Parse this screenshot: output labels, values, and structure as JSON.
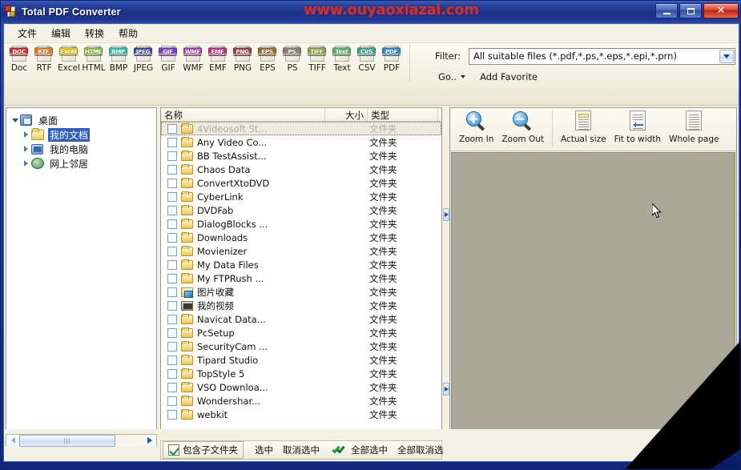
{
  "window": {
    "title": "Total PDF Converter",
    "watermark": "www.ouyaoxiazai.com",
    "minimize_label": "Minimize",
    "maximize_label": "Maximize",
    "close_label": "Close"
  },
  "menu": {
    "items": [
      {
        "label": "文件"
      },
      {
        "label": "编辑"
      },
      {
        "label": "转换"
      },
      {
        "label": "帮助"
      }
    ]
  },
  "formats": [
    {
      "label": "Doc",
      "badge": "DOC",
      "color": "#cf2b2b"
    },
    {
      "label": "RTF",
      "badge": "RTF",
      "color": "#e87722"
    },
    {
      "label": "Excel",
      "badge": "Excel",
      "color": "#e8c418"
    },
    {
      "label": "HTML",
      "badge": "HTML",
      "color": "#86c442"
    },
    {
      "label": "BMP",
      "badge": "BMP",
      "color": "#2bbfae"
    },
    {
      "label": "JPEG",
      "badge": "JPEG",
      "color": "#3647b0"
    },
    {
      "label": "GIF",
      "badge": "GIF",
      "color": "#7a3fc4"
    },
    {
      "label": "WMF",
      "badge": "WMF",
      "color": "#b03cb8"
    },
    {
      "label": "EMF",
      "badge": "EMF",
      "color": "#c42b86"
    },
    {
      "label": "PNG",
      "badge": "PNG",
      "color": "#a83a3a"
    },
    {
      "label": "EPS",
      "badge": "EPS",
      "color": "#9a6b2e"
    },
    {
      "label": "PS",
      "badge": "PS",
      "color": "#83806e"
    },
    {
      "label": "TIFF",
      "badge": "TIFF",
      "color": "#8aa642"
    },
    {
      "label": "Text",
      "badge": "Text",
      "color": "#55b36a"
    },
    {
      "label": "CSV",
      "badge": "CVS",
      "color": "#3fa58c"
    },
    {
      "label": "PDF",
      "badge": "PDF",
      "color": "#2e86c8"
    }
  ],
  "filter": {
    "label": "Filter:",
    "value": "All suitable files (*.pdf,*.ps,*.eps,*.epi,*.prn)",
    "placeholder": "All suitable files",
    "go_label": "Go..",
    "add_favorite_label": "Add Favorite"
  },
  "tree": {
    "root": {
      "label": "桌面",
      "icon": "desktop-icon"
    },
    "children": [
      {
        "label": "我的文档",
        "icon": "folder-icon",
        "selected": true
      },
      {
        "label": "我的电脑",
        "icon": "my-computer-icon",
        "selected": false
      },
      {
        "label": "网上邻居",
        "icon": "network-icon",
        "selected": false
      }
    ]
  },
  "file_list": {
    "columns": [
      {
        "key": "name",
        "label": "名称"
      },
      {
        "key": "size",
        "label": "大小"
      },
      {
        "key": "type",
        "label": "类型"
      }
    ],
    "rows": [
      {
        "name": "4Videosoft St...",
        "size": "",
        "type": "文件夹",
        "icon": "folder-icon",
        "checked": false,
        "focused": true
      },
      {
        "name": "Any Video Co...",
        "size": "",
        "type": "文件夹",
        "icon": "folder-icon",
        "checked": false,
        "focused": false
      },
      {
        "name": "BB TestAssist...",
        "size": "",
        "type": "文件夹",
        "icon": "folder-icon",
        "checked": false,
        "focused": false
      },
      {
        "name": "Chaos Data",
        "size": "",
        "type": "文件夹",
        "icon": "folder-icon",
        "checked": false,
        "focused": false
      },
      {
        "name": "ConvertXtoDVD",
        "size": "",
        "type": "文件夹",
        "icon": "folder-icon",
        "checked": false,
        "focused": false
      },
      {
        "name": "CyberLink",
        "size": "",
        "type": "文件夹",
        "icon": "folder-icon",
        "checked": false,
        "focused": false
      },
      {
        "name": "DVDFab",
        "size": "",
        "type": "文件夹",
        "icon": "folder-icon",
        "checked": false,
        "focused": false
      },
      {
        "name": "DialogBlocks ...",
        "size": "",
        "type": "文件夹",
        "icon": "folder-icon",
        "checked": false,
        "focused": false
      },
      {
        "name": "Downloads",
        "size": "",
        "type": "文件夹",
        "icon": "folder-icon",
        "checked": false,
        "focused": false
      },
      {
        "name": "Movienizer",
        "size": "",
        "type": "文件夹",
        "icon": "folder-icon",
        "checked": false,
        "focused": false
      },
      {
        "name": "My Data Files",
        "size": "",
        "type": "文件夹",
        "icon": "folder-icon",
        "checked": false,
        "focused": false
      },
      {
        "name": "My FTPRush ...",
        "size": "",
        "type": "文件夹",
        "icon": "folder-icon",
        "checked": false,
        "focused": false
      },
      {
        "name": "图片收藏",
        "size": "",
        "type": "文件夹",
        "icon": "pictures-folder-icon",
        "checked": false,
        "focused": false
      },
      {
        "name": "我的视频",
        "size": "",
        "type": "文件夹",
        "icon": "videos-folder-icon",
        "checked": false,
        "focused": false
      },
      {
        "name": "Navicat Data...",
        "size": "",
        "type": "文件夹",
        "icon": "folder-icon",
        "checked": false,
        "focused": false
      },
      {
        "name": "PcSetup",
        "size": "",
        "type": "文件夹",
        "icon": "folder-icon",
        "checked": false,
        "focused": false
      },
      {
        "name": "SecurityCam ...",
        "size": "",
        "type": "文件夹",
        "icon": "folder-icon",
        "checked": false,
        "focused": false
      },
      {
        "name": "Tipard Studio",
        "size": "",
        "type": "文件夹",
        "icon": "folder-icon",
        "checked": false,
        "focused": false
      },
      {
        "name": "TopStyle 5",
        "size": "",
        "type": "文件夹",
        "icon": "folder-icon",
        "checked": false,
        "focused": false
      },
      {
        "name": "VSO Downloa...",
        "size": "",
        "type": "文件夹",
        "icon": "folder-icon",
        "checked": false,
        "focused": false
      },
      {
        "name": "Wondershar...",
        "size": "",
        "type": "文件夹",
        "icon": "folder-icon",
        "checked": false,
        "focused": false
      },
      {
        "name": "webkit",
        "size": "",
        "type": "文件夹",
        "icon": "folder-icon",
        "checked": false,
        "focused": false
      }
    ]
  },
  "preview": {
    "tools": [
      {
        "label": "Zoom In",
        "icon": "zoom-in-icon"
      },
      {
        "label": "Zoom Out",
        "icon": "zoom-out-icon"
      },
      {
        "label": "Actual size",
        "icon": "actual-size-icon"
      },
      {
        "label": "Fit to width",
        "icon": "fit-width-icon"
      },
      {
        "label": "Whole page",
        "icon": "whole-page-icon"
      }
    ],
    "background_color": "#aca898"
  },
  "actions": [
    {
      "label": "包含子文件夹",
      "icon": "checkbox-checked-icon",
      "boxed": true
    },
    {
      "label": "选中",
      "icon": "",
      "boxed": false
    },
    {
      "label": "取消选中",
      "icon": "",
      "boxed": false
    },
    {
      "label": "全部选中",
      "icon": "double-check-icon",
      "boxed": false
    },
    {
      "label": "全部取消选",
      "icon": "",
      "boxed": false
    }
  ]
}
